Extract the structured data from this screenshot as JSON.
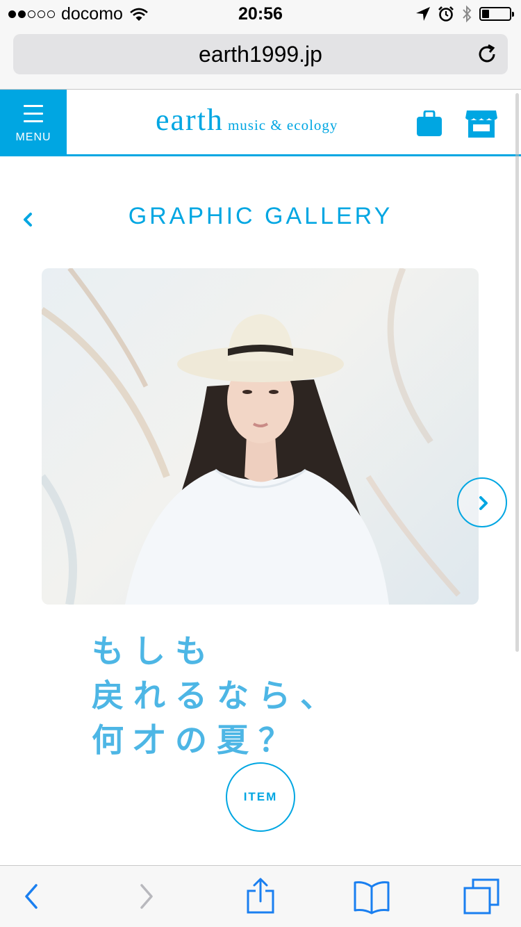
{
  "status_bar": {
    "carrier": "docomo",
    "time": "20:56",
    "signal_bars_filled": 2,
    "signal_bars_total": 5,
    "battery_level": 0.25
  },
  "browser": {
    "url": "earth1999.jp"
  },
  "site_header": {
    "menu_label": "MENU",
    "logo_main": "earth",
    "logo_sub": "music & ecology"
  },
  "gallery": {
    "title": "GRAPHIC GALLERY",
    "copy_lines": [
      "もしも",
      "戻れるなら、",
      "何才の夏？"
    ],
    "item_button": "ITEM"
  },
  "colors": {
    "accent": "#00a6e2",
    "copy_text": "#4db6e5",
    "toolbar_icon": "#1a7ff0"
  },
  "icons": {
    "reload": "reload-icon",
    "bag": "shopping-bag-icon",
    "store": "store-icon",
    "back": "chevron-left-icon",
    "next": "chevron-right-icon",
    "share": "share-icon",
    "bookmarks": "bookmarks-icon",
    "tabs": "tabs-icon"
  }
}
